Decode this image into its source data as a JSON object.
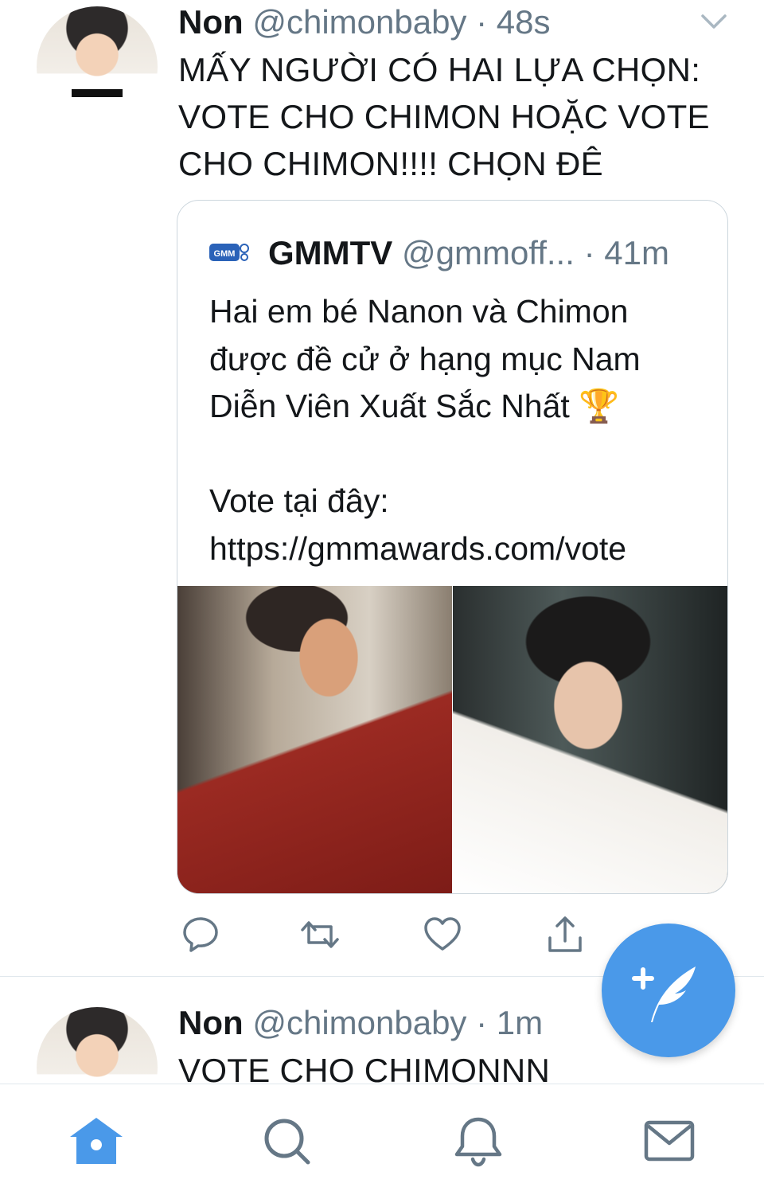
{
  "tweet1": {
    "name": "Non",
    "handle": "@chimonbaby",
    "time": "· 48s",
    "text_lines": [
      "MẤY NGƯỜI CÓ HAI LỰA CHỌN:",
      "VOTE CHO CHIMON HOẶC VOTE",
      "CHO CHIMON!!!! CHỌN ĐÊ"
    ],
    "quote": {
      "logo_text": "GMM",
      "name": "GMMTV",
      "handle": "@gmmoff...",
      "time": "· 41m",
      "text_lines": [
        "Hai em bé Nanon và Chimon",
        "được đề cử ở hạng mục Nam",
        "Diễn Viên Xuất Sắc Nhất 🏆",
        "",
        "Vote tại đây:",
        "https://gmmawards.com/vote"
      ]
    },
    "actions": [
      "reply-icon",
      "retweet-icon",
      "like-icon",
      "share-icon"
    ]
  },
  "tweet2": {
    "name": "Non",
    "handle": "@chimonbaby",
    "time": "· 1m",
    "text": "VOTE CHO CHIMONNN"
  },
  "fab": {
    "icon": "compose-tweet-icon",
    "color": "#4a99e9"
  },
  "tabbar": {
    "items": [
      "home-icon",
      "search-icon",
      "notifications-icon",
      "messages-icon"
    ],
    "active": "home-icon",
    "active_color": "#4a99e9"
  },
  "colors": {
    "primary_text": "#14171a",
    "secondary_text": "#657786",
    "accent": "#4a99e9"
  }
}
